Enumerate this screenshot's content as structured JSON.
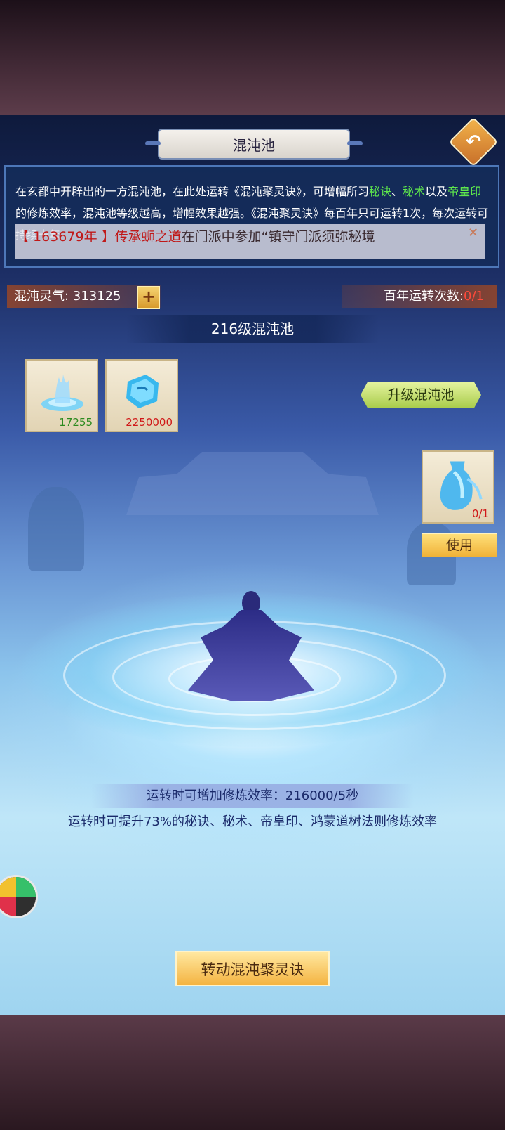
{
  "header": {
    "title": "混沌池"
  },
  "info_panel": {
    "text_part1": "在玄都中开辟出的一方混沌池，在此处运转《混沌聚灵诀》，可增幅所习",
    "highlight_1": "秘诀",
    "text_part2": "、",
    "highlight_2": "秘术",
    "text_part3": "以及",
    "highlight_3": "帝皇印",
    "text_part4": "的修炼效率，混沌池等级越高，增幅效果越强。《混沌聚灵诀》每百年只可运转1次，每次运转可持续十年"
  },
  "marquee": {
    "text_red": "【 163679年 】传承",
    "text_name": "蛳之道",
    "text_rest": "在门派中参加“镇守门派须弥秘境",
    "close_icon": "close-icon"
  },
  "stats": {
    "chaos_qi_label": "混沌灵气: 313125",
    "plus_label": "+",
    "rotation_label": "百年运转次数:",
    "rotation_value": "0/1"
  },
  "level_banner": "216级混沌池",
  "materials": [
    {
      "name": "spirit-fountain-icon",
      "count": "17255"
    },
    {
      "name": "blue-crystal-icon",
      "count": "2250000"
    }
  ],
  "upgrade_button": "升级混沌池",
  "consumable": {
    "icon": "spirit-vase-icon",
    "count": "0/1",
    "use_label": "使用"
  },
  "efficiency": {
    "banner": "运转时可增加修炼效率：216000/5秒",
    "desc": "运转时可提升73%的秘诀、秘术、帝皇印、鸿蒙道树法则修炼效率"
  },
  "rotate_button": "转动混沌聚灵诀",
  "colors": {
    "highlight_green": "#5ee84c",
    "marquee_red": "#c01818",
    "count_green": "#2b8a1e",
    "count_red": "#d01818"
  }
}
